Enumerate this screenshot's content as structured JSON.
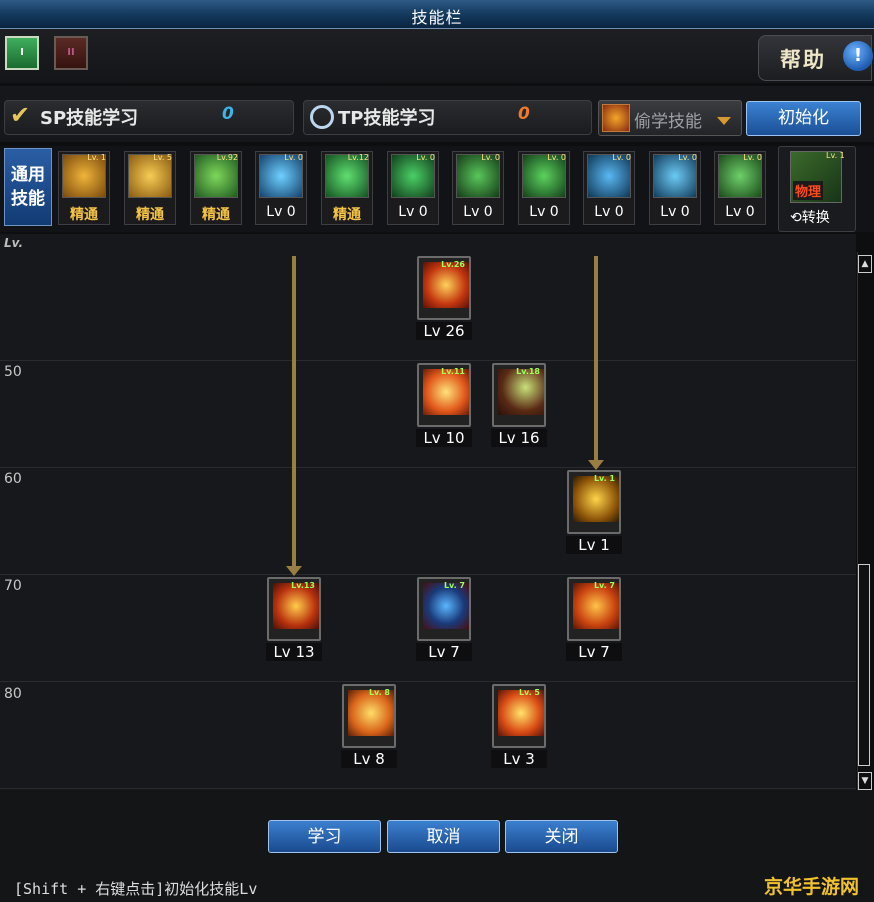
{
  "window": {
    "title": "技能栏"
  },
  "tabs": [
    {
      "label": "I"
    },
    {
      "label": "II"
    }
  ],
  "help": {
    "label": "帮助",
    "icon": "!"
  },
  "points": {
    "sp": {
      "label": "SP技能学习",
      "value": "0"
    },
    "tp": {
      "label": "TP技能学习",
      "value": "0"
    }
  },
  "steal": {
    "label": "偷学技能"
  },
  "reset": {
    "label": "初始化"
  },
  "common": {
    "label_line1": "通用",
    "label_line2": "技能",
    "skills": [
      {
        "top": "Lv. 1",
        "level": "精通",
        "mastered": true,
        "icon": "yellow-warrior-icon"
      },
      {
        "top": "Lv. 5",
        "level": "精通",
        "mastered": true,
        "icon": "yellow-swirl-icon"
      },
      {
        "top": "Lv.92",
        "level": "精通",
        "mastered": true,
        "icon": "green-dash-icon"
      },
      {
        "top": "Lv. 0",
        "level": "Lv 0",
        "mastered": false,
        "icon": "blue-wings-icon"
      },
      {
        "top": "Lv.12",
        "level": "精通",
        "mastered": true,
        "icon": "green-target-icon"
      },
      {
        "top": "Lv. 0",
        "level": "Lv 0",
        "mastered": false,
        "icon": "green-crosshair-icon"
      },
      {
        "top": "Lv. 0",
        "level": "Lv 0",
        "mastered": false,
        "icon": "green-figure-icon"
      },
      {
        "top": "Lv. 0",
        "level": "Lv 0",
        "mastered": false,
        "icon": "green-kick-icon"
      },
      {
        "top": "Lv. 0",
        "level": "Lv 0",
        "mastered": false,
        "icon": "blue-eye-icon"
      },
      {
        "top": "Lv. 0",
        "level": "Lv 0",
        "mastered": false,
        "icon": "blue-body-icon"
      },
      {
        "top": "Lv. 0",
        "level": "Lv 0",
        "mastered": false,
        "icon": "green-leg-icon"
      }
    ],
    "convert": {
      "top": "Lv. 1",
      "tag": "物理",
      "label": "⟲转换"
    }
  },
  "tree": {
    "header": "Lv.",
    "level_marks": [
      "50",
      "60",
      "70",
      "80"
    ],
    "skills": [
      {
        "top": "Lv.26",
        "level": "Lv 26",
        "icon": "fire-burst-icon"
      },
      {
        "top": "Lv.11",
        "level": "Lv 10",
        "icon": "sun-flare-icon"
      },
      {
        "top": "Lv.18",
        "level": "Lv 16",
        "icon": "crescent-slash-icon"
      },
      {
        "top": "Lv. 1",
        "level": "Lv 1",
        "icon": "golden-whirl-icon"
      },
      {
        "top": "Lv.13",
        "level": "Lv 13",
        "icon": "fire-cross-icon"
      },
      {
        "top": "Lv. 7",
        "level": "Lv 7",
        "icon": "blue-flame-icon"
      },
      {
        "top": "Lv. 7",
        "level": "Lv 7",
        "icon": "flame-wing-icon"
      },
      {
        "top": "Lv. 8",
        "level": "Lv 8",
        "icon": "fire-wave-icon"
      },
      {
        "top": "Lv. 5",
        "level": "Lv 3",
        "icon": "star-burst-icon"
      }
    ]
  },
  "buttons": {
    "learn": "学习",
    "cancel": "取消",
    "close": "关闭"
  },
  "hint": "[Shift + 右键点击]初始化技能Lv",
  "watermark": "京华手游网",
  "colors": {
    "accent_blue": "#2a68b6",
    "arrow": "#9a7d43",
    "mastered": "#f6c443",
    "sp": "#3db3e6",
    "tp": "#ef7a2a"
  }
}
